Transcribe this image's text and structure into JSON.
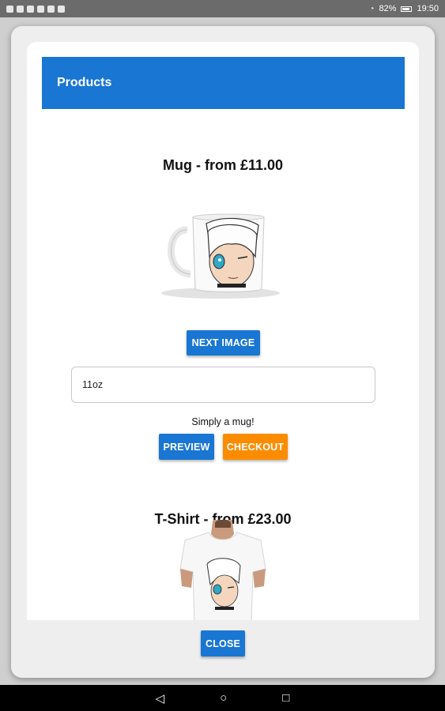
{
  "status_bar": {
    "battery": "82%",
    "time": "19:50"
  },
  "dialog": {
    "header_title": "Products",
    "products": [
      {
        "title": "Mug - from £11.00",
        "next_image_label": "NEXT IMAGE",
        "size_value": "11oz",
        "description": "Simply a mug!",
        "preview_label": "PREVIEW",
        "checkout_label": "CHECKOUT"
      },
      {
        "title": "T-Shirt - from £23.00"
      }
    ],
    "close_label": "CLOSE"
  },
  "nav_bar": {
    "back_icon": "◁",
    "home_icon": "○",
    "recents_icon": "□"
  },
  "colors": {
    "primary": "#1976d2",
    "accent": "#fb8c00"
  }
}
